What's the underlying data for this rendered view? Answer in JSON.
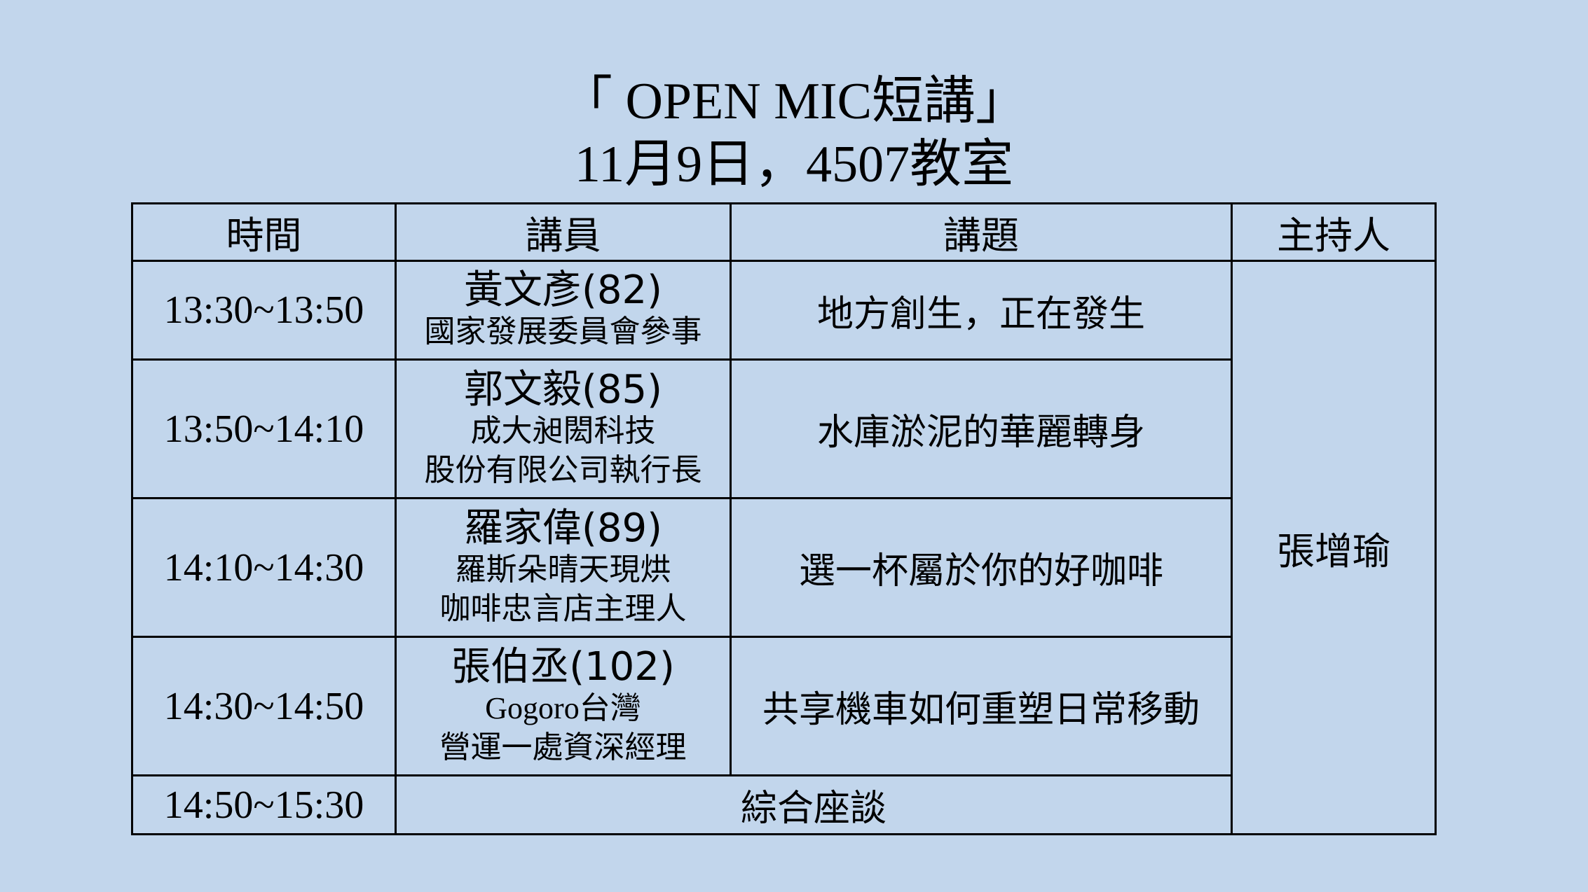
{
  "title": {
    "line1": "「 OPEN MIC短講」",
    "line2": "11月9日，4507教室"
  },
  "table": {
    "headers": [
      "時間",
      "講員",
      "講題",
      "主持人"
    ],
    "rows": [
      {
        "time": "13:30~13:50",
        "speaker_name": "黃文彥(82)",
        "affiliation_lines": [
          "國家發展委員會參事"
        ],
        "topic": "地方創生，正在發生"
      },
      {
        "time": "13:50~14:10",
        "speaker_name": "郭文毅(85)",
        "affiliation_lines": [
          "成大昶閎科技",
          "股份有限公司執行長"
        ],
        "topic": "水庫淤泥的華麗轉身"
      },
      {
        "time": "14:10~14:30",
        "speaker_name": "羅家偉(89)",
        "affiliation_lines": [
          "羅斯朵晴天現烘",
          "咖啡忠言店主理人"
        ],
        "topic": "選一杯屬於你的好咖啡"
      },
      {
        "time": "14:30~14:50",
        "speaker_name": "張伯丞(102)",
        "affiliation_lines": [
          "Gogoro台灣",
          "營運一處資深經理"
        ],
        "topic": "共享機車如何重塑日常移動"
      }
    ],
    "final_row": {
      "time": "14:50~15:30",
      "topic": "綜合座談"
    },
    "host": "張增瑜"
  }
}
